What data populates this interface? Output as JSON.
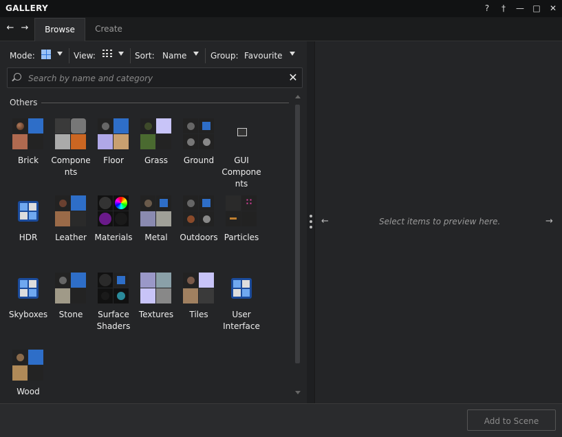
{
  "window": {
    "title": "GALLERY",
    "controls": [
      "?",
      "†",
      "—",
      "□",
      "✕"
    ]
  },
  "nav": {
    "tabs": [
      {
        "label": "Browse",
        "active": true
      },
      {
        "label": "Create",
        "active": false
      }
    ]
  },
  "toolbar": {
    "mode_label": "Mode:",
    "view_label": "View:",
    "sort_label": "Sort:",
    "sort_value": "Name",
    "group_label": "Group:",
    "group_value": "Favourite"
  },
  "search": {
    "placeholder": "Search by name and category",
    "value": ""
  },
  "section": {
    "title": "Others"
  },
  "items": [
    {
      "label": "Brick",
      "icon": "material-quad"
    },
    {
      "label": "Compone\nnts",
      "icon": "components"
    },
    {
      "label": "Floor",
      "icon": "material-quad"
    },
    {
      "label": "Grass",
      "icon": "material-quad"
    },
    {
      "label": "Ground",
      "icon": "material-quad"
    },
    {
      "label": "GUI\nCompone\nnts",
      "icon": "gui-icon"
    },
    {
      "label": "HDR",
      "icon": "category-icon"
    },
    {
      "label": "Leather",
      "icon": "material-quad"
    },
    {
      "label": "Materials",
      "icon": "spheres"
    },
    {
      "label": "Metal",
      "icon": "material-quad"
    },
    {
      "label": "Outdoors",
      "icon": "material-quad"
    },
    {
      "label": "Particles",
      "icon": "particles"
    },
    {
      "label": "Skyboxes",
      "icon": "category-icon"
    },
    {
      "label": "Stone",
      "icon": "material-quad"
    },
    {
      "label": "Surface\nShaders",
      "icon": "spheres"
    },
    {
      "label": "Textures",
      "icon": "material-quad"
    },
    {
      "label": "Tiles",
      "icon": "material-quad"
    },
    {
      "label": "User\nInterface",
      "icon": "category-icon"
    },
    {
      "label": "Wood",
      "icon": "material-quad"
    }
  ],
  "preview": {
    "text": "Select items to preview here."
  },
  "footer": {
    "add_button": "Add to Scene"
  },
  "colors": {
    "background": "#202224",
    "panel": "#242527",
    "accent": "#2a72d8"
  }
}
